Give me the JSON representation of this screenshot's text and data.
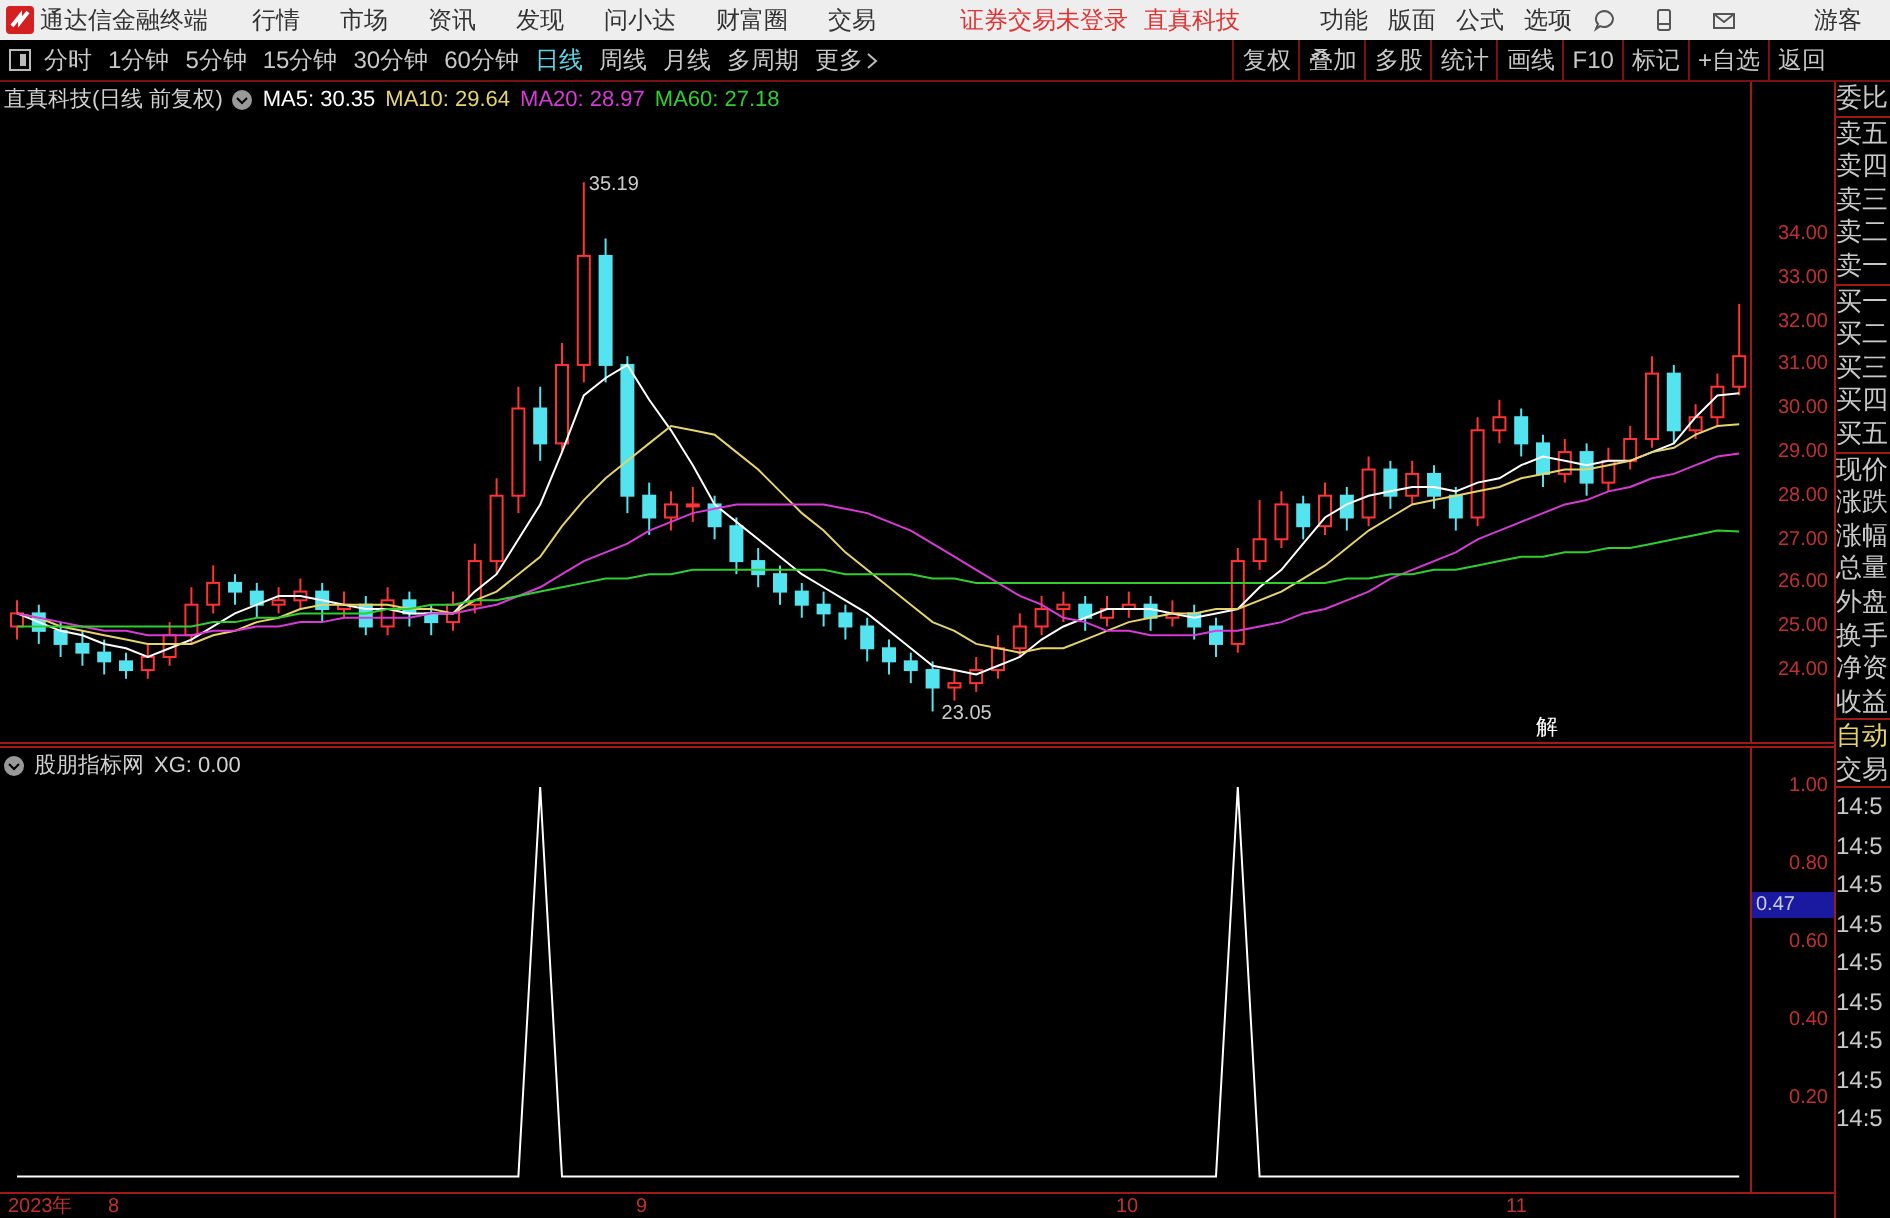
{
  "menu_bar": {
    "app_title": "通达信金融终端",
    "menus": [
      "行情",
      "市场",
      "资讯",
      "发现",
      "问小达",
      "财富圈",
      "交易"
    ],
    "notice": "证券交易未登录",
    "stock_link": "直真科技",
    "right_menus": [
      "功能",
      "版面",
      "公式",
      "选项"
    ],
    "user": "游客"
  },
  "toolbar": {
    "periods": [
      {
        "label": "分时",
        "selected": false
      },
      {
        "label": "1分钟",
        "selected": false
      },
      {
        "label": "5分钟",
        "selected": false
      },
      {
        "label": "15分钟",
        "selected": false
      },
      {
        "label": "30分钟",
        "selected": false
      },
      {
        "label": "60分钟",
        "selected": false
      },
      {
        "label": "日线",
        "selected": true
      },
      {
        "label": "周线",
        "selected": false
      },
      {
        "label": "月线",
        "selected": false
      },
      {
        "label": "多周期",
        "selected": false
      },
      {
        "label": "更多",
        "selected": false
      }
    ],
    "actions": [
      "复权",
      "叠加",
      "多股",
      "统计",
      "画线",
      "F10",
      "标记",
      "+自选",
      "返回"
    ]
  },
  "main_chart": {
    "title": "直真科技(日线 前复权)",
    "high_label": "35.19",
    "low_label": "23.05",
    "marker": "解",
    "chart_data": {
      "type": "candlestick",
      "ylim": [
        22.35,
        37.49
      ],
      "yticks": [
        {
          "value": 34,
          "label": "34.00"
        },
        {
          "value": 33,
          "label": "33.00"
        },
        {
          "value": 32,
          "label": "32.00"
        },
        {
          "value": 31,
          "label": "31.00"
        },
        {
          "value": 30,
          "label": "30.00"
        },
        {
          "value": 29,
          "label": "29.00"
        },
        {
          "value": 28,
          "label": "28.00"
        },
        {
          "value": 27,
          "label": "27.00"
        },
        {
          "value": 26,
          "label": "26.00"
        },
        {
          "value": 25,
          "label": "25.00"
        },
        {
          "value": 24,
          "label": "24.00"
        }
      ],
      "ohlc": [
        [
          25.0,
          25.6,
          24.7,
          25.3
        ],
        [
          25.3,
          25.5,
          24.6,
          24.9
        ],
        [
          24.9,
          25.1,
          24.3,
          24.6
        ],
        [
          24.6,
          24.9,
          24.1,
          24.4
        ],
        [
          24.4,
          24.7,
          23.9,
          24.2
        ],
        [
          24.2,
          24.4,
          23.8,
          24.0
        ],
        [
          24.0,
          24.6,
          23.8,
          24.3
        ],
        [
          24.3,
          25.1,
          24.1,
          24.8
        ],
        [
          24.8,
          25.9,
          24.6,
          25.5
        ],
        [
          25.5,
          26.4,
          25.3,
          26.0
        ],
        [
          26.0,
          26.2,
          25.5,
          25.8
        ],
        [
          25.8,
          26.0,
          25.2,
          25.5
        ],
        [
          25.5,
          25.9,
          25.3,
          25.6
        ],
        [
          25.6,
          26.1,
          25.4,
          25.8
        ],
        [
          25.8,
          26.0,
          25.1,
          25.4
        ],
        [
          25.4,
          25.8,
          25.2,
          25.5
        ],
        [
          25.5,
          25.7,
          24.8,
          25.0
        ],
        [
          25.0,
          25.9,
          24.8,
          25.6
        ],
        [
          25.6,
          25.8,
          25.0,
          25.3
        ],
        [
          25.3,
          25.5,
          24.8,
          25.1
        ],
        [
          25.1,
          25.8,
          24.9,
          25.5
        ],
        [
          25.5,
          26.9,
          25.3,
          26.5
        ],
        [
          26.5,
          28.4,
          26.2,
          28.0
        ],
        [
          28.0,
          30.5,
          27.6,
          30.0
        ],
        [
          30.0,
          30.5,
          28.8,
          29.2
        ],
        [
          29.2,
          31.5,
          29.0,
          31.0
        ],
        [
          31.0,
          35.19,
          30.6,
          33.5
        ],
        [
          33.5,
          33.9,
          30.6,
          31.0
        ],
        [
          31.0,
          31.2,
          27.6,
          28.0
        ],
        [
          28.0,
          28.3,
          27.1,
          27.5
        ],
        [
          27.5,
          28.1,
          27.2,
          27.8
        ],
        [
          27.8,
          28.2,
          27.4,
          27.8
        ],
        [
          27.8,
          28.0,
          27.0,
          27.3
        ],
        [
          27.3,
          27.5,
          26.2,
          26.5
        ],
        [
          26.5,
          26.8,
          25.9,
          26.2
        ],
        [
          26.2,
          26.4,
          25.5,
          25.8
        ],
        [
          25.8,
          26.0,
          25.2,
          25.5
        ],
        [
          25.5,
          25.8,
          25.0,
          25.3
        ],
        [
          25.3,
          25.5,
          24.7,
          25.0
        ],
        [
          25.0,
          25.2,
          24.2,
          24.5
        ],
        [
          24.5,
          24.7,
          23.9,
          24.2
        ],
        [
          24.2,
          24.4,
          23.7,
          24.0
        ],
        [
          24.0,
          24.2,
          23.05,
          23.6
        ],
        [
          23.6,
          24.0,
          23.3,
          23.7
        ],
        [
          23.7,
          24.3,
          23.5,
          24.0
        ],
        [
          24.0,
          24.8,
          23.8,
          24.5
        ],
        [
          24.5,
          25.3,
          24.3,
          25.0
        ],
        [
          25.0,
          25.7,
          24.8,
          25.4
        ],
        [
          25.4,
          25.8,
          25.1,
          25.5
        ],
        [
          25.5,
          25.7,
          24.9,
          25.2
        ],
        [
          25.2,
          25.7,
          25.0,
          25.4
        ],
        [
          25.4,
          25.8,
          25.2,
          25.5
        ],
        [
          25.5,
          25.7,
          24.9,
          25.2
        ],
        [
          25.2,
          25.6,
          25.0,
          25.3
        ],
        [
          25.3,
          25.5,
          24.7,
          25.0
        ],
        [
          25.0,
          25.2,
          24.3,
          24.6
        ],
        [
          24.6,
          26.8,
          24.4,
          26.5
        ],
        [
          26.5,
          27.9,
          26.3,
          27.0
        ],
        [
          27.0,
          28.1,
          26.8,
          27.8
        ],
        [
          27.8,
          28.0,
          27.0,
          27.3
        ],
        [
          27.3,
          28.3,
          27.1,
          28.0
        ],
        [
          28.0,
          28.2,
          27.2,
          27.5
        ],
        [
          27.5,
          28.9,
          27.3,
          28.6
        ],
        [
          28.6,
          28.8,
          27.7,
          28.0
        ],
        [
          28.0,
          28.8,
          27.8,
          28.5
        ],
        [
          28.5,
          28.7,
          27.7,
          28.0
        ],
        [
          28.0,
          28.2,
          27.2,
          27.5
        ],
        [
          27.5,
          29.8,
          27.3,
          29.5
        ],
        [
          29.5,
          30.2,
          29.2,
          29.8
        ],
        [
          29.8,
          30.0,
          28.9,
          29.2
        ],
        [
          29.2,
          29.4,
          28.2,
          28.5
        ],
        [
          28.5,
          29.3,
          28.3,
          29.0
        ],
        [
          29.0,
          29.2,
          28.0,
          28.3
        ],
        [
          28.3,
          29.1,
          28.1,
          28.8
        ],
        [
          28.8,
          29.6,
          28.6,
          29.3
        ],
        [
          29.3,
          31.2,
          29.1,
          30.8
        ],
        [
          30.8,
          31.0,
          29.2,
          29.5
        ],
        [
          29.5,
          30.1,
          29.3,
          29.8
        ],
        [
          29.8,
          30.8,
          29.6,
          30.5
        ],
        [
          30.5,
          32.4,
          30.3,
          31.2
        ]
      ],
      "series": [
        {
          "name": "MA5: 30.35",
          "type": "line",
          "color": "#ffffff",
          "values": [
            25.3,
            25.1,
            24.9,
            24.8,
            24.6,
            24.5,
            24.3,
            24.5,
            24.7,
            25.0,
            25.3,
            25.5,
            25.7,
            25.7,
            25.6,
            25.5,
            25.4,
            25.4,
            25.3,
            25.3,
            25.3,
            25.8,
            26.2,
            27.0,
            27.8,
            29.0,
            30.3,
            30.7,
            31.0,
            30.2,
            29.5,
            28.7,
            27.8,
            27.4,
            27.0,
            26.6,
            26.2,
            25.9,
            25.6,
            25.3,
            24.9,
            24.5,
            24.1,
            24.0,
            23.9,
            24.1,
            24.3,
            24.7,
            25.0,
            25.2,
            25.4,
            25.4,
            25.4,
            25.3,
            25.2,
            25.3,
            25.4,
            25.9,
            26.3,
            26.9,
            27.5,
            27.8,
            28.0,
            28.1,
            28.2,
            28.2,
            28.1,
            28.3,
            28.4,
            28.7,
            28.9,
            28.8,
            28.7,
            28.8,
            28.8,
            29.0,
            29.2,
            29.8,
            30.3,
            30.35
          ]
        },
        {
          "name": "MA10: 29.64",
          "type": "line",
          "color": "#e6d36a",
          "values": [
            25.3,
            25.2,
            25.0,
            24.9,
            24.8,
            24.7,
            24.6,
            24.6,
            24.6,
            24.8,
            24.9,
            25.1,
            25.2,
            25.4,
            25.5,
            25.5,
            25.5,
            25.5,
            25.4,
            25.4,
            25.3,
            25.6,
            25.8,
            26.2,
            26.6,
            27.3,
            27.9,
            28.4,
            28.8,
            29.2,
            29.6,
            29.5,
            29.4,
            29.0,
            28.6,
            28.1,
            27.6,
            27.2,
            26.7,
            26.3,
            25.9,
            25.5,
            25.1,
            24.9,
            24.6,
            24.5,
            24.4,
            24.5,
            24.5,
            24.7,
            24.9,
            25.1,
            25.2,
            25.3,
            25.3,
            25.4,
            25.4,
            25.6,
            25.8,
            26.1,
            26.4,
            26.8,
            27.2,
            27.5,
            27.8,
            27.9,
            28.0,
            28.1,
            28.2,
            28.4,
            28.5,
            28.6,
            28.6,
            28.7,
            28.8,
            29.0,
            29.1,
            29.4,
            29.6,
            29.64
          ]
        },
        {
          "name": "MA20: 28.97",
          "type": "line",
          "color": "#d83ad8",
          "values": [
            25.3,
            25.2,
            25.1,
            25.0,
            24.9,
            24.9,
            24.8,
            24.8,
            24.8,
            24.9,
            24.9,
            25.0,
            25.0,
            25.1,
            25.1,
            25.2,
            25.2,
            25.2,
            25.2,
            25.3,
            25.3,
            25.4,
            25.5,
            25.7,
            25.9,
            26.2,
            26.5,
            26.7,
            26.9,
            27.2,
            27.4,
            27.6,
            27.7,
            27.8,
            27.8,
            27.8,
            27.8,
            27.8,
            27.7,
            27.6,
            27.4,
            27.2,
            26.9,
            26.6,
            26.3,
            26.0,
            25.7,
            25.5,
            25.2,
            25.1,
            24.9,
            24.9,
            24.8,
            24.8,
            24.8,
            24.9,
            24.9,
            25.0,
            25.1,
            25.3,
            25.4,
            25.6,
            25.8,
            26.1,
            26.3,
            26.5,
            26.7,
            27.0,
            27.2,
            27.4,
            27.6,
            27.8,
            27.9,
            28.1,
            28.2,
            28.4,
            28.5,
            28.7,
            28.9,
            28.97
          ]
        },
        {
          "name": "MA60: 27.18",
          "type": "line",
          "color": "#2ecf2e",
          "values": [
            25.0,
            25.0,
            25.0,
            25.0,
            25.0,
            25.0,
            25.0,
            25.0,
            25.0,
            25.1,
            25.1,
            25.2,
            25.2,
            25.3,
            25.3,
            25.3,
            25.3,
            25.4,
            25.4,
            25.5,
            25.5,
            25.6,
            25.6,
            25.7,
            25.8,
            25.9,
            26.0,
            26.1,
            26.1,
            26.2,
            26.2,
            26.3,
            26.3,
            26.3,
            26.3,
            26.3,
            26.3,
            26.3,
            26.2,
            26.2,
            26.2,
            26.2,
            26.1,
            26.1,
            26.0,
            26.0,
            26.0,
            26.0,
            26.0,
            26.0,
            26.0,
            26.0,
            26.0,
            26.0,
            26.0,
            26.0,
            26.0,
            26.0,
            26.0,
            26.0,
            26.0,
            26.1,
            26.1,
            26.2,
            26.2,
            26.3,
            26.3,
            26.4,
            26.5,
            26.6,
            26.6,
            26.7,
            26.7,
            26.8,
            26.8,
            26.9,
            27.0,
            27.1,
            27.2,
            27.18
          ]
        }
      ]
    }
  },
  "indicator": {
    "title": "股朋指标网",
    "cursor_value": "0.47",
    "chart_data": {
      "type": "line",
      "ylim": [
        -0.04,
        1.1
      ],
      "yticks": [
        {
          "value": 1,
          "label": "1.00"
        },
        {
          "value": 0.8,
          "label": "0.80"
        },
        {
          "value": 0.6,
          "label": "0.60"
        },
        {
          "value": 0.4,
          "label": "0.40"
        },
        {
          "value": 0.2,
          "label": "0.20"
        }
      ],
      "series": [
        {
          "name": "XG: 0.00",
          "color": "#ffffff",
          "values": [
            0,
            0,
            0,
            0,
            0,
            0,
            0,
            0,
            0,
            0,
            0,
            0,
            0,
            0,
            0,
            0,
            0,
            0,
            0,
            0,
            0,
            0,
            0,
            0,
            1,
            0,
            0,
            0,
            0,
            0,
            0,
            0,
            0,
            0,
            0,
            0,
            0,
            0,
            0,
            0,
            0,
            0,
            0,
            0,
            0,
            0,
            0,
            0,
            0,
            0,
            0,
            0,
            0,
            0,
            0,
            0,
            1,
            0,
            0,
            0,
            0,
            0,
            0,
            0,
            0,
            0,
            0,
            0,
            0,
            0,
            0,
            0,
            0,
            0,
            0,
            0,
            0,
            0,
            0,
            0
          ]
        }
      ]
    }
  },
  "time_axis": [
    "2023年",
    "8",
    "9",
    "10",
    "11"
  ],
  "quote_panel": {
    "items": [
      "委比",
      "卖五",
      "卖四",
      "卖三",
      "卖二",
      "卖一",
      "买一",
      "买二",
      "买三",
      "买四",
      "买五",
      "现价",
      "涨跌",
      "涨幅",
      "总量",
      "外盘",
      "换手",
      "净资",
      "收益"
    ],
    "auto_label": "自动",
    "trade_label": "交易",
    "times": [
      "14:5",
      "14:5",
      "14:5",
      "14:5",
      "14:5",
      "14:5",
      "14:5",
      "14:5",
      "14:5"
    ]
  }
}
